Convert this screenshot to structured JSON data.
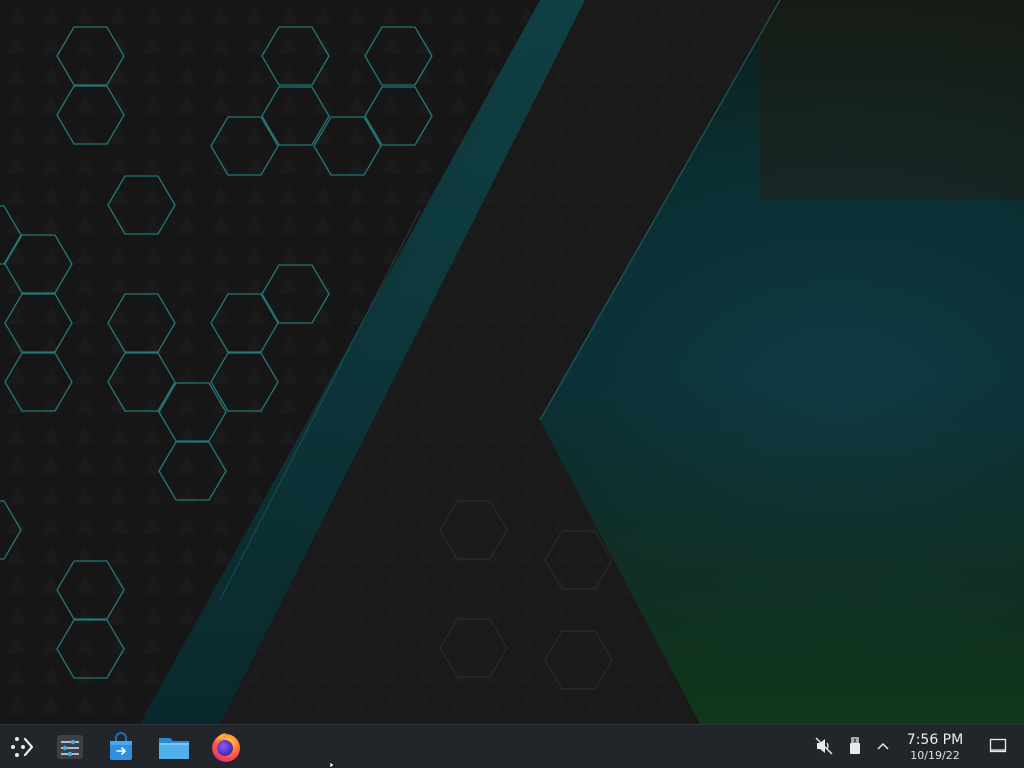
{
  "desktop": {
    "wallpaper": "dark hexagon and triangle abstract",
    "accent_color": "#2aa0a0"
  },
  "taskbar": {
    "background": "#22262b",
    "launchers": [
      {
        "name": "application-launcher",
        "icon": "kde-launcher-icon"
      },
      {
        "name": "system-settings",
        "icon": "settings-sliders-icon"
      },
      {
        "name": "discover-store",
        "icon": "shopping-bag-icon"
      },
      {
        "name": "file-manager",
        "icon": "folder-icon"
      },
      {
        "name": "firefox",
        "icon": "firefox-icon"
      }
    ],
    "tray": {
      "volume_icon": "speaker-muted-icon",
      "device_icon": "usb-drive-icon",
      "expand_icon": "chevron-up-icon"
    },
    "clock": {
      "time": "7:56 PM",
      "date": "10/19/22"
    },
    "show_desktop_icon": "show-desktop-icon"
  }
}
